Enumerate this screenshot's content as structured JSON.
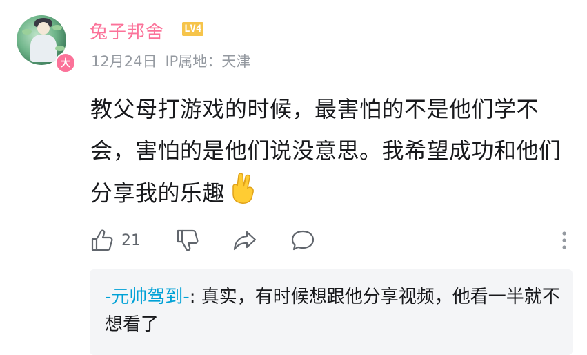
{
  "comment": {
    "username": "兔子邦舍",
    "level": "LV4",
    "badge": "大",
    "date": "12月24日",
    "ip_location": "IP属地：天津",
    "text": "教父母打游戏的时候，最害怕的不是他们学不会，害怕的是他们说没意思。我希望成功和他们分享我的乐趣",
    "emoji": "finger-crossed-emoji",
    "like_count": "21"
  },
  "reply": {
    "username": "-元帅驾到-",
    "separator": ": ",
    "text": "真实，有时候想跟他分享视频，他看一半就不想看了"
  },
  "colors": {
    "username": "#fb7299",
    "level_badge": "#f6c44a",
    "meta": "#9499a0",
    "reply_user": "#00a1d6",
    "reply_bg": "#f4f5f7"
  },
  "icons": [
    "avatar",
    "thumbs-up-icon",
    "thumbs-down-icon",
    "share-icon",
    "reply-icon",
    "more-vertical-icon"
  ]
}
